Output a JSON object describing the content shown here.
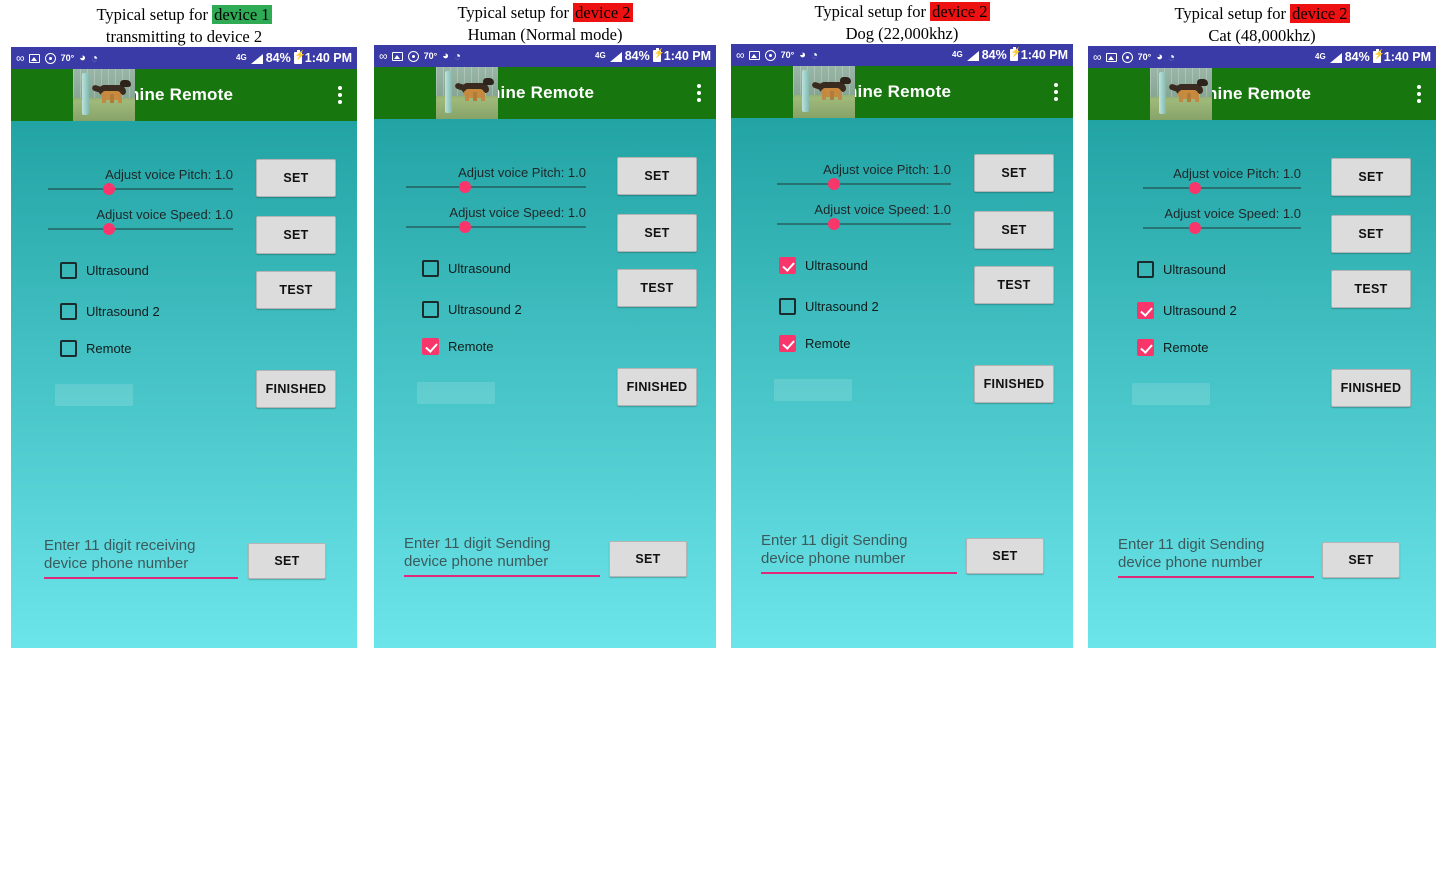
{
  "figure": {
    "panel_count": 4
  },
  "panels": [
    {
      "caption_prefix": "Typical setup for ",
      "caption_highlight": "device 1",
      "caption_highlight_color": "green",
      "caption_line2": "transmitting to device 2",
      "statusbar": {
        "icons": [
          "voicemail-icon",
          "image-icon",
          "cd-icon",
          "temperature-icon",
          "flame-icon",
          "wave-icon"
        ],
        "temperature": "70°",
        "network": "4G",
        "battery_percent": "84%",
        "time": "1:40 PM"
      },
      "appbar": {
        "title": "Canine Remote",
        "thumbnail": "dog-photo",
        "overflow": "kebab-menu-icon"
      },
      "sliders": [
        {
          "label": "Adjust voice Pitch: 1.0",
          "value": 1.0,
          "position_pct": 33,
          "button": "SET"
        },
        {
          "label": "Adjust voice Speed: 1.0",
          "value": 1.0,
          "position_pct": 33,
          "button": "SET"
        }
      ],
      "checkboxes": [
        {
          "label": "Ultrasound",
          "checked": false
        },
        {
          "label": "Ultrasound 2",
          "checked": false
        },
        {
          "label": "Remote",
          "checked": false
        }
      ],
      "test_button": "TEST",
      "finished_button": "FINISHED",
      "phone_input": {
        "placeholder": "Enter 11 digit receiving\ndevice phone number",
        "value": "",
        "button": "SET"
      }
    },
    {
      "caption_prefix": "Typical setup for ",
      "caption_highlight": "device 2",
      "caption_highlight_color": "red",
      "caption_line2": "Human (Normal mode)",
      "statusbar": {
        "icons": [
          "voicemail-icon",
          "image-icon",
          "cd-icon",
          "temperature-icon",
          "flame-icon",
          "wave-icon"
        ],
        "temperature": "70°",
        "network": "4G",
        "battery_percent": "84%",
        "time": "1:40 PM"
      },
      "appbar": {
        "title": "Canine Remote",
        "thumbnail": "dog-photo",
        "overflow": "kebab-menu-icon"
      },
      "sliders": [
        {
          "label": "Adjust voice Pitch: 1.0",
          "value": 1.0,
          "position_pct": 33,
          "button": "SET"
        },
        {
          "label": "Adjust voice Speed: 1.0",
          "value": 1.0,
          "position_pct": 33,
          "button": "SET"
        }
      ],
      "checkboxes": [
        {
          "label": "Ultrasound",
          "checked": false
        },
        {
          "label": "Ultrasound 2",
          "checked": false
        },
        {
          "label": "Remote",
          "checked": true
        }
      ],
      "test_button": "TEST",
      "finished_button": "FINISHED",
      "phone_input": {
        "placeholder": "Enter 11 digit Sending\ndevice phone number",
        "value": "",
        "button": "SET"
      }
    },
    {
      "caption_prefix": "Typical setup for ",
      "caption_highlight": "device 2",
      "caption_highlight_color": "red",
      "caption_line2": "Dog (22,000khz)",
      "statusbar": {
        "icons": [
          "voicemail-icon",
          "image-icon",
          "cd-icon",
          "temperature-icon",
          "flame-icon",
          "wave-icon"
        ],
        "temperature": "70°",
        "network": "4G",
        "battery_percent": "84%",
        "time": "1:40 PM"
      },
      "appbar": {
        "title": "Canine Remote",
        "thumbnail": "dog-photo",
        "overflow": "kebab-menu-icon"
      },
      "sliders": [
        {
          "label": "Adjust voice Pitch: 1.0",
          "value": 1.0,
          "position_pct": 33,
          "button": "SET"
        },
        {
          "label": "Adjust voice Speed: 1.0",
          "value": 1.0,
          "position_pct": 33,
          "button": "SET"
        }
      ],
      "checkboxes": [
        {
          "label": "Ultrasound",
          "checked": true
        },
        {
          "label": "Ultrasound 2",
          "checked": false
        },
        {
          "label": "Remote",
          "checked": true
        }
      ],
      "test_button": "TEST",
      "finished_button": "FINISHED",
      "phone_input": {
        "placeholder": "Enter 11 digit Sending\ndevice phone number",
        "value": "",
        "button": "SET"
      }
    },
    {
      "caption_prefix": "Typical setup for ",
      "caption_highlight": "device 2",
      "caption_highlight_color": "red",
      "caption_line2": "Cat (48,000khz)",
      "statusbar": {
        "icons": [
          "voicemail-icon",
          "image-icon",
          "cd-icon",
          "temperature-icon",
          "flame-icon",
          "wave-icon"
        ],
        "temperature": "70°",
        "network": "4G",
        "battery_percent": "84%",
        "time": "1:40 PM"
      },
      "appbar": {
        "title": "Canine Remote",
        "thumbnail": "dog-photo",
        "overflow": "kebab-menu-icon"
      },
      "sliders": [
        {
          "label": "Adjust voice Pitch: 1.0",
          "value": 1.0,
          "position_pct": 33,
          "button": "SET"
        },
        {
          "label": "Adjust voice Speed: 1.0",
          "value": 1.0,
          "position_pct": 33,
          "button": "SET"
        }
      ],
      "checkboxes": [
        {
          "label": "Ultrasound",
          "checked": false
        },
        {
          "label": "Ultrasound 2",
          "checked": true
        },
        {
          "label": "Remote",
          "checked": true
        }
      ],
      "test_button": "TEST",
      "finished_button": "FINISHED",
      "phone_input": {
        "placeholder": "Enter 11 digit Sending\ndevice phone number",
        "value": "",
        "button": "SET"
      }
    }
  ],
  "colors": {
    "statusbar": "#3b3ba8",
    "appbar": "#17760d",
    "accent_pink": "#f8366b",
    "input_underline": "#e0297a",
    "bg_top": "#189a9a",
    "bg_bottom": "#6ce5ea",
    "highlight_green": "#2faa55",
    "highlight_red": "#ee1111",
    "button_face": "#dcdcdc"
  }
}
